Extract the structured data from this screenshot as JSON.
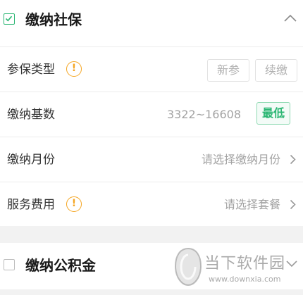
{
  "sections": {
    "social_insurance": {
      "title": "缴纳社保",
      "checked": true
    },
    "housing_fund": {
      "title": "缴纳公积金",
      "checked": false
    }
  },
  "rows": {
    "insurance_type": {
      "label": "参保类型",
      "options": [
        "新参",
        "续缴"
      ]
    },
    "base": {
      "label": "缴纳基数",
      "range": "3322~16608",
      "min_button": "最低"
    },
    "month": {
      "label": "缴纳月份",
      "placeholder": "请选择缴纳月份"
    },
    "service_fee": {
      "label": "服务费用",
      "placeholder": "请选择套餐"
    }
  },
  "icons": {
    "info": "!"
  },
  "colors": {
    "accent": "#2bb673",
    "warning": "#f5a623"
  },
  "watermark": {
    "name": "当下软件园",
    "url": "www.downxia.com"
  }
}
